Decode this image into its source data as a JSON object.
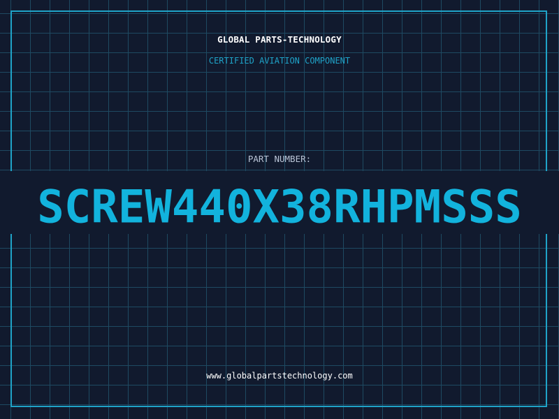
{
  "header": {
    "company": "GLOBAL PARTS-TECHNOLOGY",
    "tagline": "CERTIFIED AVIATION COMPONENT"
  },
  "part": {
    "label": "PART NUMBER:",
    "number": "SCREW440X38RHPMSSS"
  },
  "footer": {
    "website": "www.globalpartstechnology.com"
  },
  "colors": {
    "background": "#111a2e",
    "grid": "#1e4a62",
    "accent": "#1fa3c8",
    "part_number": "#12b3dd",
    "text": "#ffffff"
  }
}
